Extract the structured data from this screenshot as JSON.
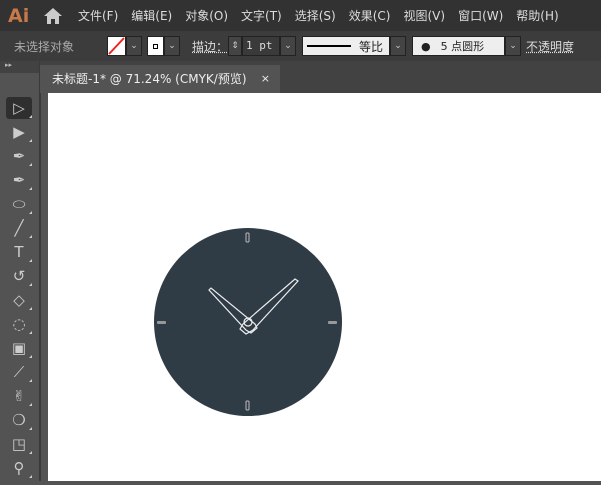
{
  "app": {
    "logo": "Ai"
  },
  "menu": [
    "文件(F)",
    "编辑(E)",
    "对象(O)",
    "文字(T)",
    "选择(S)",
    "效果(C)",
    "视图(V)",
    "窗口(W)",
    "帮助(H)"
  ],
  "control": {
    "selection": "未选择对象",
    "stroke_label": "描边：",
    "stroke_value": "1 pt",
    "profile": "等比",
    "brush_size": "5",
    "brush": "点圆形",
    "opacity": "不透明度"
  },
  "tab": {
    "title": "未标题-1* @ 71.24% (CMYK/预览)",
    "close": "×"
  },
  "tools": [
    "selection-tool",
    "direct-selection-tool",
    "pen-tool",
    "curvature-tool",
    "ellipse-tool",
    "paintbrush-tool",
    "type-tool",
    "rotate-tool",
    "eraser-tool",
    "shape-builder-tool",
    "gradient-tool",
    "eyedropper-tool",
    "puppet-warp-tool",
    "blend-tool",
    "artboard-tool",
    "zoom-tool"
  ],
  "colors": {
    "clock_face": "#2f3b45",
    "accent": "#c8794a"
  }
}
